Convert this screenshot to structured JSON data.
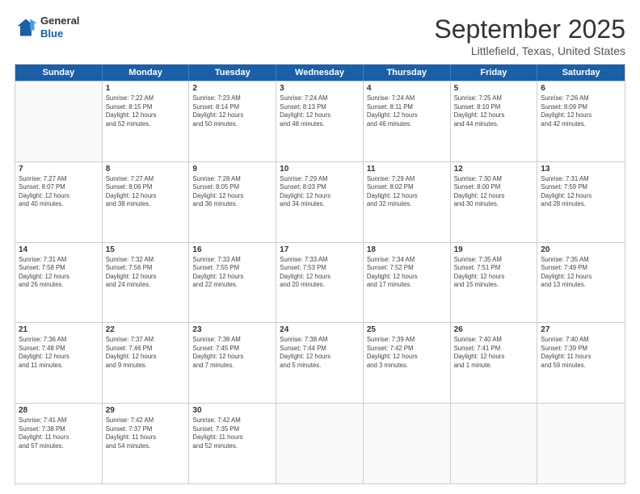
{
  "logo": {
    "line1": "General",
    "line2": "Blue"
  },
  "title": "September 2025",
  "subtitle": "Littlefield, Texas, United States",
  "header_days": [
    "Sunday",
    "Monday",
    "Tuesday",
    "Wednesday",
    "Thursday",
    "Friday",
    "Saturday"
  ],
  "rows": [
    [
      {
        "day": "",
        "info": ""
      },
      {
        "day": "1",
        "info": "Sunrise: 7:22 AM\nSunset: 8:15 PM\nDaylight: 12 hours\nand 52 minutes."
      },
      {
        "day": "2",
        "info": "Sunrise: 7:23 AM\nSunset: 8:14 PM\nDaylight: 12 hours\nand 50 minutes."
      },
      {
        "day": "3",
        "info": "Sunrise: 7:24 AM\nSunset: 8:13 PM\nDaylight: 12 hours\nand 48 minutes."
      },
      {
        "day": "4",
        "info": "Sunrise: 7:24 AM\nSunset: 8:11 PM\nDaylight: 12 hours\nand 46 minutes."
      },
      {
        "day": "5",
        "info": "Sunrise: 7:25 AM\nSunset: 8:10 PM\nDaylight: 12 hours\nand 44 minutes."
      },
      {
        "day": "6",
        "info": "Sunrise: 7:26 AM\nSunset: 8:09 PM\nDaylight: 12 hours\nand 42 minutes."
      }
    ],
    [
      {
        "day": "7",
        "info": "Sunrise: 7:27 AM\nSunset: 8:07 PM\nDaylight: 12 hours\nand 40 minutes."
      },
      {
        "day": "8",
        "info": "Sunrise: 7:27 AM\nSunset: 8:06 PM\nDaylight: 12 hours\nand 38 minutes."
      },
      {
        "day": "9",
        "info": "Sunrise: 7:28 AM\nSunset: 8:05 PM\nDaylight: 12 hours\nand 36 minutes."
      },
      {
        "day": "10",
        "info": "Sunrise: 7:29 AM\nSunset: 8:03 PM\nDaylight: 12 hours\nand 34 minutes."
      },
      {
        "day": "11",
        "info": "Sunrise: 7:29 AM\nSunset: 8:02 PM\nDaylight: 12 hours\nand 32 minutes."
      },
      {
        "day": "12",
        "info": "Sunrise: 7:30 AM\nSunset: 8:00 PM\nDaylight: 12 hours\nand 30 minutes."
      },
      {
        "day": "13",
        "info": "Sunrise: 7:31 AM\nSunset: 7:59 PM\nDaylight: 12 hours\nand 28 minutes."
      }
    ],
    [
      {
        "day": "14",
        "info": "Sunrise: 7:31 AM\nSunset: 7:58 PM\nDaylight: 12 hours\nand 26 minutes."
      },
      {
        "day": "15",
        "info": "Sunrise: 7:32 AM\nSunset: 7:56 PM\nDaylight: 12 hours\nand 24 minutes."
      },
      {
        "day": "16",
        "info": "Sunrise: 7:33 AM\nSunset: 7:55 PM\nDaylight: 12 hours\nand 22 minutes."
      },
      {
        "day": "17",
        "info": "Sunrise: 7:33 AM\nSunset: 7:53 PM\nDaylight: 12 hours\nand 20 minutes."
      },
      {
        "day": "18",
        "info": "Sunrise: 7:34 AM\nSunset: 7:52 PM\nDaylight: 12 hours\nand 17 minutes."
      },
      {
        "day": "19",
        "info": "Sunrise: 7:35 AM\nSunset: 7:51 PM\nDaylight: 12 hours\nand 15 minutes."
      },
      {
        "day": "20",
        "info": "Sunrise: 7:35 AM\nSunset: 7:49 PM\nDaylight: 12 hours\nand 13 minutes."
      }
    ],
    [
      {
        "day": "21",
        "info": "Sunrise: 7:36 AM\nSunset: 7:48 PM\nDaylight: 12 hours\nand 11 minutes."
      },
      {
        "day": "22",
        "info": "Sunrise: 7:37 AM\nSunset: 7:46 PM\nDaylight: 12 hours\nand 9 minutes."
      },
      {
        "day": "23",
        "info": "Sunrise: 7:38 AM\nSunset: 7:45 PM\nDaylight: 12 hours\nand 7 minutes."
      },
      {
        "day": "24",
        "info": "Sunrise: 7:38 AM\nSunset: 7:44 PM\nDaylight: 12 hours\nand 5 minutes."
      },
      {
        "day": "25",
        "info": "Sunrise: 7:39 AM\nSunset: 7:42 PM\nDaylight: 12 hours\nand 3 minutes."
      },
      {
        "day": "26",
        "info": "Sunrise: 7:40 AM\nSunset: 7:41 PM\nDaylight: 12 hours\nand 1 minute."
      },
      {
        "day": "27",
        "info": "Sunrise: 7:40 AM\nSunset: 7:39 PM\nDaylight: 11 hours\nand 59 minutes."
      }
    ],
    [
      {
        "day": "28",
        "info": "Sunrise: 7:41 AM\nSunset: 7:38 PM\nDaylight: 11 hours\nand 57 minutes."
      },
      {
        "day": "29",
        "info": "Sunrise: 7:42 AM\nSunset: 7:37 PM\nDaylight: 11 hours\nand 54 minutes."
      },
      {
        "day": "30",
        "info": "Sunrise: 7:42 AM\nSunset: 7:35 PM\nDaylight: 11 hours\nand 52 minutes."
      },
      {
        "day": "",
        "info": ""
      },
      {
        "day": "",
        "info": ""
      },
      {
        "day": "",
        "info": ""
      },
      {
        "day": "",
        "info": ""
      }
    ]
  ]
}
